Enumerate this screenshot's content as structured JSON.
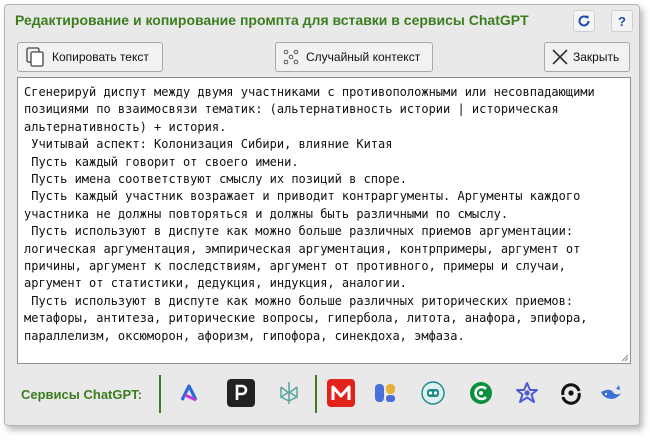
{
  "dialog": {
    "title": "Редактирование и копирование промпта для вставки в сервисы ChatGPT",
    "refresh_icon": "refresh-icon",
    "help_label": "?"
  },
  "toolbar": {
    "copy_label": "Копировать текст",
    "random_label": "Случайный контекст",
    "close_label": "Закрыть"
  },
  "prompt": {
    "text": "Сгенерируй диспут между двумя участниками с противоположными или несовпадающими позициями по взаимосвязи тематик: (альтернативность истории | историческая альтернативность) + история.\n Учитывай аспект: Колонизация Сибири, влияние Китая\n Пусть каждый говорит от своего имени.\n Пусть имена соответствуют смыслу их позиций в споре.\n Пусть каждый участник возражает и приводит контраргументы. Аргументы каждого участника не должны повторяться и должны быть различными по смыслу.\n Пусть используют в диспуте как можно больше различных приемов аргументации: логическая аргументация, эмпирическая аргументация, контрпримеры, аргумент от причины, аргумент к последствиям, аргумент от противного, примеры и случаи, аргумент от статистики, дедукция, индукция, аналогии.\n Пусть используют в диспуте как можно больше различных риторических приемов: метафоры, антитеза, риторические вопросы, гипербола, литота, анафора, эпифора, параллелизм, оксюморон, афоризм, гипофора, синекдоха, эмфаза."
  },
  "services": {
    "label": "Сервисы ChatGPT",
    "separator": ":",
    "items": [
      {
        "name": "perplexity-like-service",
        "icon": "k-logo",
        "color": "#2f6bd8"
      },
      {
        "name": "p-service",
        "icon": "p-logo",
        "color": "#222222"
      },
      {
        "name": "perplexity-service",
        "icon": "perplexity-logo",
        "color": "#5aa6a0"
      },
      {
        "name": "m-service",
        "icon": "m-logo",
        "color": "#e2231a"
      },
      {
        "name": "two-blocks-service",
        "icon": "blocks-logo",
        "color": "#4b6fd9"
      },
      {
        "name": "robot-service",
        "icon": "robot-logo",
        "color": "#1d8a8a"
      },
      {
        "name": "green-c-service",
        "icon": "green-c-logo",
        "color": "#0a8f3c"
      },
      {
        "name": "star-ai-service",
        "icon": "star-logo",
        "color": "#4b5bd6"
      },
      {
        "name": "swirl-service",
        "icon": "swirl-logo",
        "color": "#111111"
      },
      {
        "name": "whale-service",
        "icon": "whale-logo",
        "color": "#3f6fd8"
      }
    ]
  }
}
